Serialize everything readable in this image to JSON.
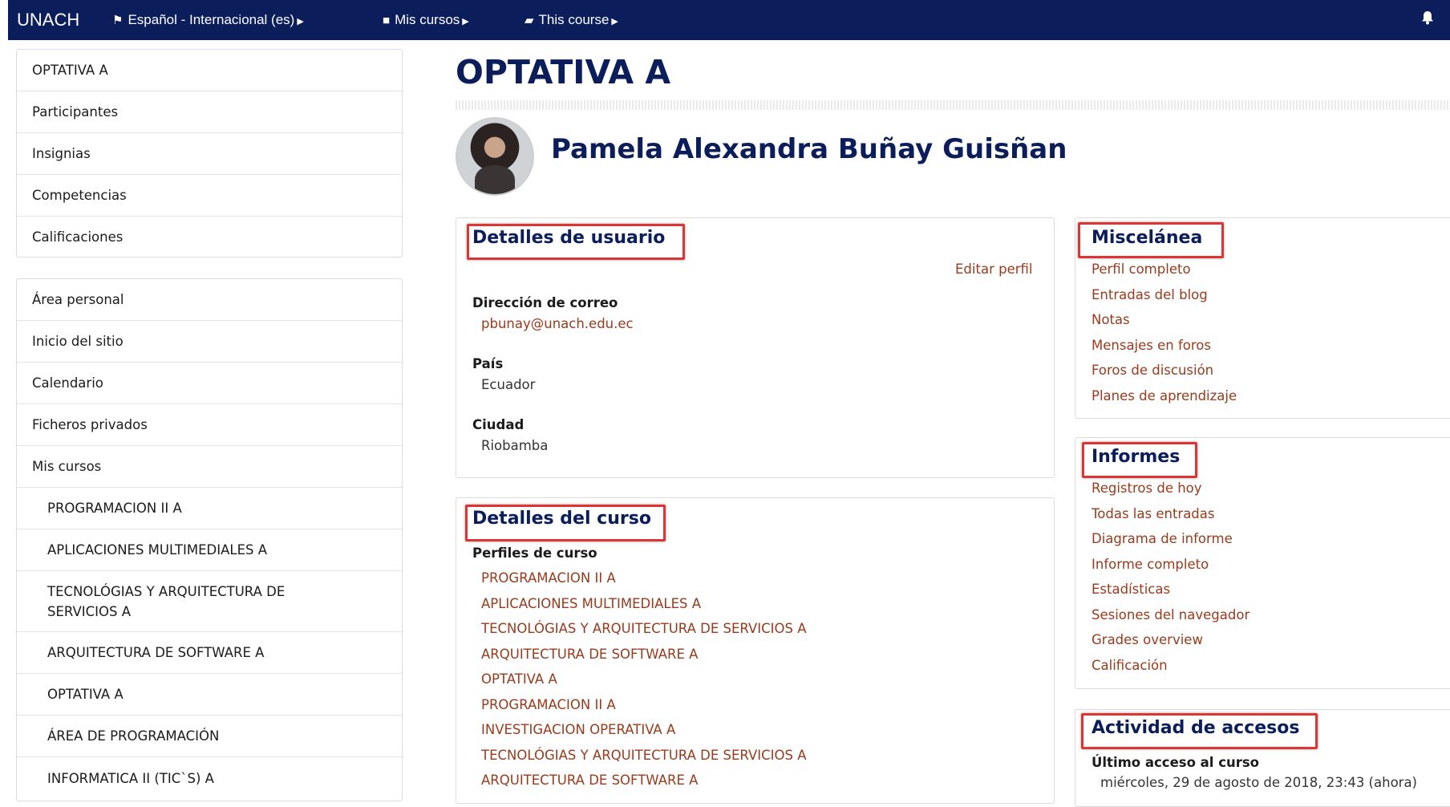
{
  "navbar": {
    "brand": "UNACH",
    "language": "Español - Internacional (es)",
    "my_courses": "Mis cursos",
    "this_course": "This course"
  },
  "sidebar": {
    "course_nav": [
      "OPTATIVA A",
      "Participantes",
      "Insignias",
      "Competencias",
      "Calificaciones"
    ],
    "main_nav": [
      "Área personal",
      "Inicio del sitio",
      "Calendario",
      "Ficheros privados",
      "Mis cursos"
    ],
    "courses": [
      "PROGRAMACION II A",
      "APLICACIONES MULTIMEDIALES A",
      "TECNOLÓGIAS Y ARQUITECTURA DE SERVICIOS A",
      "ARQUITECTURA DE SOFTWARE A",
      "OPTATIVA A",
      "ÁREA DE PROGRAMACIÓN",
      "INFORMATICA II (TIC`S) A"
    ]
  },
  "page": {
    "title": "OPTATIVA A",
    "user_name": "Pamela Alexandra Buñay Guisñan"
  },
  "user_details": {
    "title": "Detalles de usuario",
    "edit_profile": "Editar perfil",
    "email_label": "Dirección de correo",
    "email": "pbunay@unach.edu.ec",
    "country_label": "País",
    "country": "Ecuador",
    "city_label": "Ciudad",
    "city": "Riobamba"
  },
  "course_details": {
    "title": "Detalles del curso",
    "profiles_label": "Perfiles de curso",
    "profiles": [
      "PROGRAMACION II A",
      "APLICACIONES MULTIMEDIALES A",
      "TECNOLÓGIAS Y ARQUITECTURA DE SERVICIOS A",
      "ARQUITECTURA DE SOFTWARE A",
      "OPTATIVA A",
      "PROGRAMACION II A",
      "INVESTIGACION OPERATIVA A",
      "TECNOLÓGIAS Y ARQUITECTURA DE SERVICIOS A",
      "ARQUITECTURA DE SOFTWARE A"
    ]
  },
  "misc": {
    "title": "Miscelánea",
    "links": [
      "Perfil completo",
      "Entradas del blog",
      "Notas",
      "Mensajes en foros",
      "Foros de discusión",
      "Planes de aprendizaje"
    ]
  },
  "reports": {
    "title": "Informes",
    "links": [
      "Registros de hoy",
      "Todas las entradas",
      "Diagrama de informe",
      "Informe completo",
      "Estadísticas",
      "Sesiones del navegador",
      "Grades overview",
      "Calificación"
    ]
  },
  "access": {
    "title": "Actividad de accesos",
    "last_access_label": "Último acceso al curso",
    "last_access_value": "miércoles, 29 de agosto de 2018, 23:43  (ahora)"
  },
  "colors": {
    "navbar": "#0b1e5b",
    "link": "#9a3a1c",
    "highlight": "#e03333"
  }
}
